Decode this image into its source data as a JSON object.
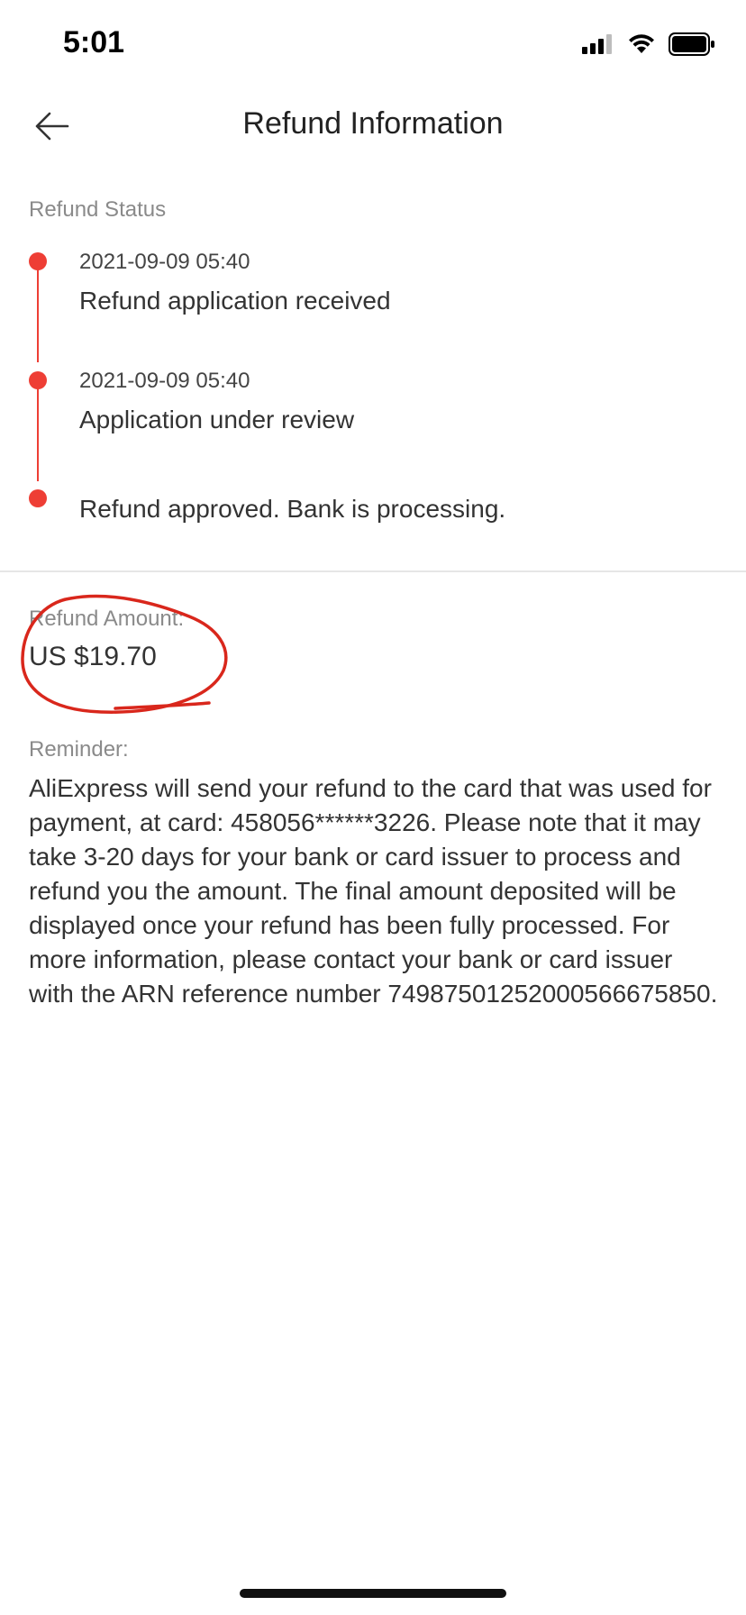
{
  "status_bar": {
    "time": "5:01",
    "icons": [
      "cellular-signal-icon",
      "wifi-icon",
      "battery-icon"
    ]
  },
  "header": {
    "back_icon": "arrow-left-icon",
    "title": "Refund Information"
  },
  "refund_status": {
    "label": "Refund Status",
    "steps": [
      {
        "time": "2021-09-09 05:40",
        "text": "Refund application received"
      },
      {
        "time": "2021-09-09 05:40",
        "text": "Application under review"
      },
      {
        "time": "",
        "text": "Refund approved. Bank is processing."
      }
    ]
  },
  "refund_amount": {
    "label": "Refund Amount:",
    "value": "US $19.70"
  },
  "reminder": {
    "label": "Reminder:",
    "text": "AliExpress will send your refund to the card that was used for payment, at card: 458056******3226. Please note that it may take 3-20 days for your bank or card issuer to process and refund you the amount. The final amount deposited will be displayed once your refund has been fully processed. For more information, please contact your bank or card issuer with the ARN reference number 74987501252000566675850."
  },
  "colors": {
    "accent": "#ee3e35",
    "annotation": "#d9271c",
    "text": "#333333",
    "muted": "#8a8a8a"
  }
}
